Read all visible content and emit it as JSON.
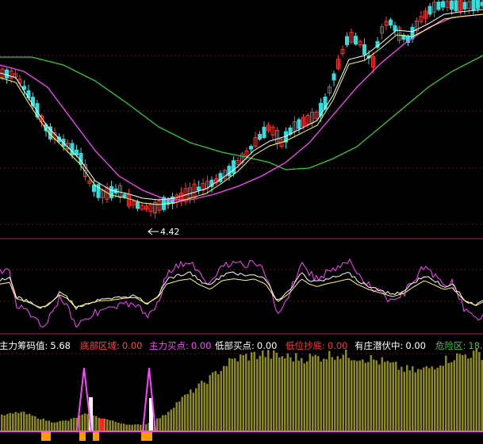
{
  "chart_data": [
    {
      "type": "candlestick",
      "panel": "main",
      "min_price_annotation": "4.42",
      "moving_average_colors": [
        "#ffffff",
        "#ffff66",
        "#ff44ff",
        "#33cc33"
      ],
      "grid": true,
      "up_color": "#ff3333",
      "down_color": "#33dddd"
    },
    {
      "type": "line",
      "panel": "oscillator",
      "series_colors": [
        "#ff44ff",
        "#ffffff",
        "#ffff66"
      ],
      "grid": true
    },
    {
      "type": "bar",
      "panel": "indicator",
      "legend": [
        {
          "label": "主力筹码值:",
          "value": "5.68",
          "color": "#ffffff"
        },
        {
          "label": "底部区域:",
          "value": "0.00",
          "color": "#ff4444"
        },
        {
          "label": "主力买点:",
          "value": "0.00",
          "color": "#ff44ff"
        },
        {
          "label": "低部买点:",
          "value": "0.00",
          "color": "#ffffff"
        },
        {
          "label": "低位抄底:",
          "value": "0.00",
          "color": "#ff3333"
        },
        {
          "label": "有庄潜伏中:",
          "value": "0.00",
          "color": "#ffffff"
        },
        {
          "label": "危险区:",
          "value": "18.",
          "color": "#33cc33"
        }
      ],
      "bar_color": "#8c8a1e",
      "signal_colors": {
        "buy_line": "#ff44ff",
        "bottom_zone": "#ff9900",
        "low_buy": "#ffffff",
        "bottom_buy": "#ff2222"
      }
    }
  ]
}
